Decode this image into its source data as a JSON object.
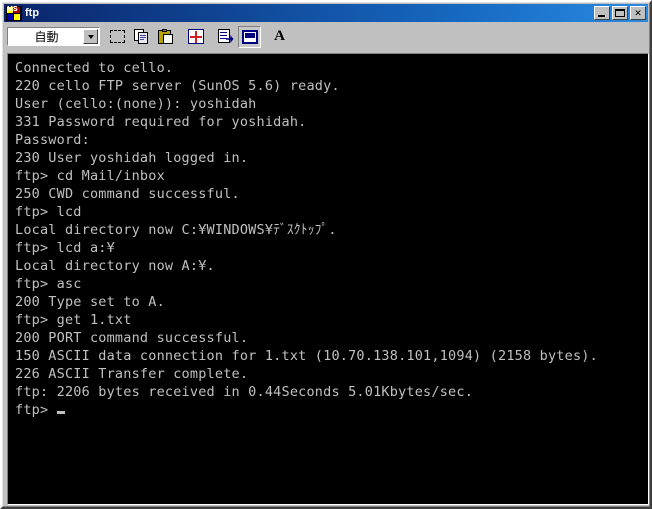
{
  "window": {
    "title": "ftp",
    "icon": "ms-dos-prompt-icon",
    "controls": {
      "minimize_label": "_",
      "maximize_label": "□",
      "close_label": "✕"
    }
  },
  "toolbar": {
    "font_size_combo": {
      "value": "自動",
      "options": [
        "自動"
      ]
    },
    "buttons": [
      {
        "name": "mark-button",
        "icon": "mark-selection-icon"
      },
      {
        "name": "copy-button",
        "icon": "copy-icon"
      },
      {
        "name": "paste-button",
        "icon": "paste-icon"
      },
      {
        "name": "scroll-all-button",
        "icon": "move-arrows-icon"
      },
      {
        "name": "properties-button",
        "icon": "properties-icon"
      },
      {
        "name": "background-button",
        "icon": "background-window-icon",
        "pressed": true
      },
      {
        "name": "font-button",
        "icon": "font-letter-a-icon",
        "glyph": "A"
      }
    ]
  },
  "console": {
    "prompt_symbol": "ftp>",
    "cursor": "_",
    "lines": [
      "Connected to cello.",
      "220 cello FTP server (SunOS 5.6) ready.",
      "User (cello:(none)): yoshidah",
      "331 Password required for yoshidah.",
      "Password:",
      "230 User yoshidah logged in.",
      "ftp> cd Mail/inbox",
      "250 CWD command successful.",
      "ftp> lcd",
      "Local directory now C:¥WINDOWS¥ﾃﾞｽｸﾄｯﾌﾟ.",
      "ftp> lcd a:¥",
      "Local directory now A:¥.",
      "ftp> asc",
      "200 Type set to A.",
      "ftp> get 1.txt",
      "200 PORT command successful.",
      "150 ASCII data connection for 1.txt (10.70.138.101,1094) (2158 bytes).",
      "226 ASCII Transfer complete.",
      "ftp: 2206 bytes received in 0.44Seconds 5.01Kbytes/sec.",
      "ftp> "
    ]
  },
  "colors": {
    "title_gradient_start": "#0a246a",
    "title_gradient_end": "#2a8ae0",
    "window_face": "#c0c0c0",
    "console_bg": "#000000",
    "console_fg": "#c0c0c0"
  }
}
